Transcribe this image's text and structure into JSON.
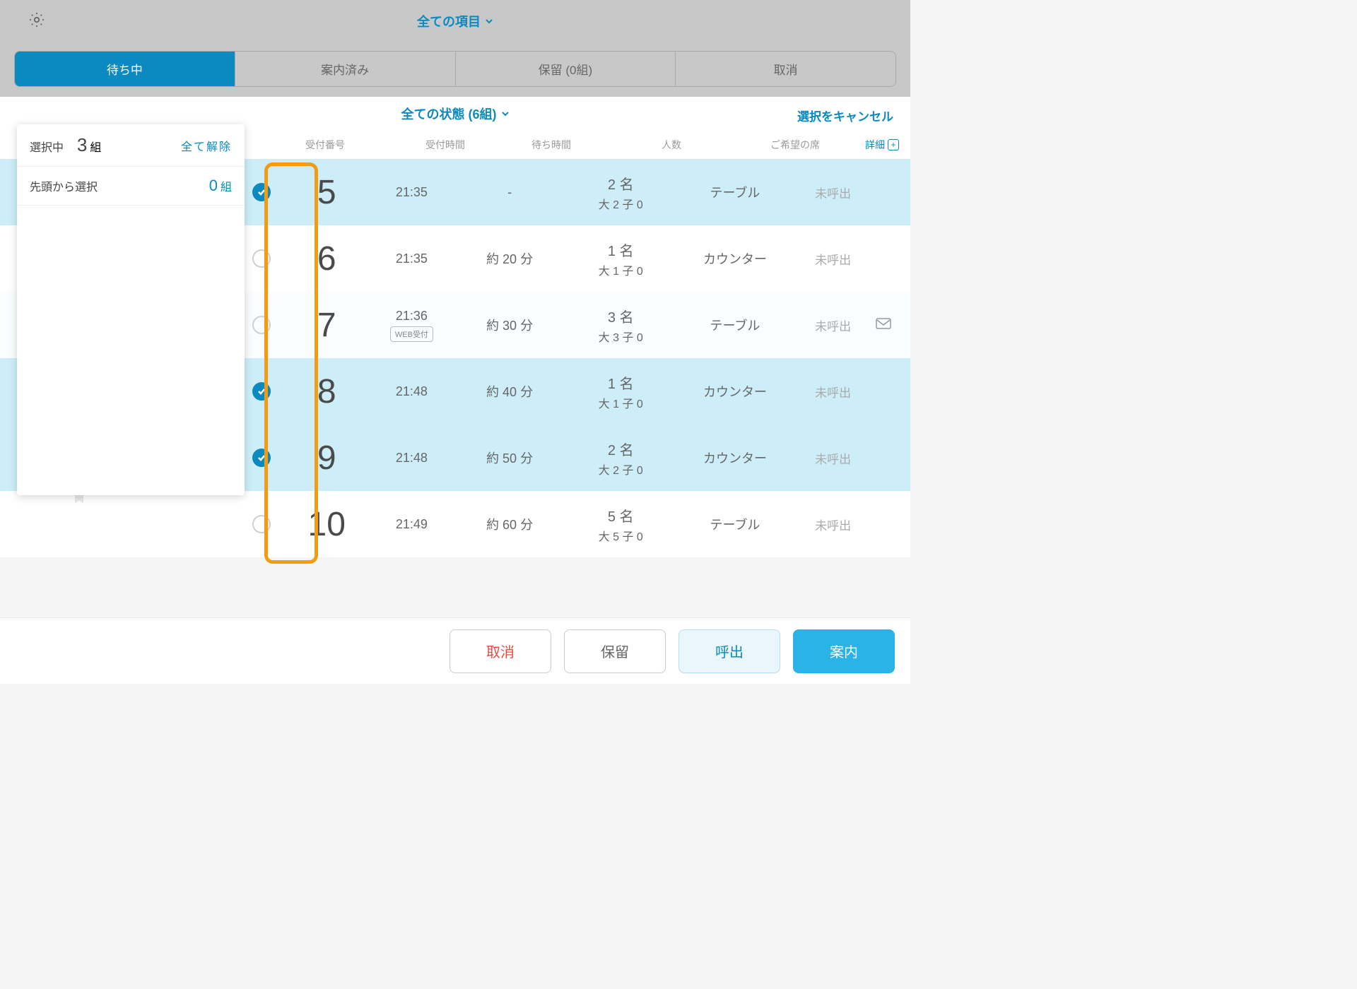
{
  "colors": {
    "accent": "#0a8abf"
  },
  "header": {
    "title": "全ての項目"
  },
  "tabs": {
    "waiting": "待ち中",
    "done": "案内済み",
    "hold": "保留 (0組)",
    "cancelled": "取消"
  },
  "filter": {
    "label": "全ての状態 (6組)",
    "cancel_selection": "選択をキャンセル"
  },
  "columns": {
    "number": "受付番号",
    "time": "受付時間",
    "wait": "待ち時間",
    "party": "人数",
    "seat": "ご希望の席",
    "details": "詳細"
  },
  "panel": {
    "selecting_label": "選択中",
    "selecting_count": "3",
    "selecting_unit": "組",
    "clear_all": "全て解除",
    "from_top": "先頭から選択",
    "from_top_value": "0",
    "from_top_unit": "組"
  },
  "rows": [
    {
      "selected": true,
      "num": "5",
      "time": "21:35",
      "web": false,
      "wait": "-",
      "party": "2",
      "adults": "2",
      "kids": "0",
      "seat": "テーブル",
      "status": "未呼出",
      "mail": false
    },
    {
      "selected": false,
      "num": "6",
      "time": "21:35",
      "web": false,
      "wait": "約 20 分",
      "party": "1",
      "adults": "1",
      "kids": "0",
      "seat": "カウンター",
      "status": "未呼出",
      "mail": false
    },
    {
      "selected": false,
      "num": "7",
      "time": "21:36",
      "web": true,
      "wait": "約 30 分",
      "party": "3",
      "adults": "3",
      "kids": "0",
      "seat": "テーブル",
      "status": "未呼出",
      "mail": true
    },
    {
      "selected": true,
      "num": "8",
      "time": "21:48",
      "web": false,
      "wait": "約 40 分",
      "party": "1",
      "adults": "1",
      "kids": "0",
      "seat": "カウンター",
      "status": "未呼出",
      "mail": false
    },
    {
      "selected": true,
      "num": "9",
      "time": "21:48",
      "web": false,
      "wait": "約 50 分",
      "party": "2",
      "adults": "2",
      "kids": "0",
      "seat": "カウンター",
      "status": "未呼出",
      "mail": false
    },
    {
      "selected": false,
      "num": "10",
      "time": "21:49",
      "web": false,
      "wait": "約 60 分",
      "party": "5",
      "adults": "5",
      "kids": "0",
      "seat": "テーブル",
      "status": "未呼出",
      "mail": false
    }
  ],
  "web_badge": "WEB受付",
  "party_labels": {
    "suffix": "名",
    "adult": "大",
    "kid": "子"
  },
  "actions": {
    "cancel": "取消",
    "hold": "保留",
    "call": "呼出",
    "guide": "案内"
  }
}
